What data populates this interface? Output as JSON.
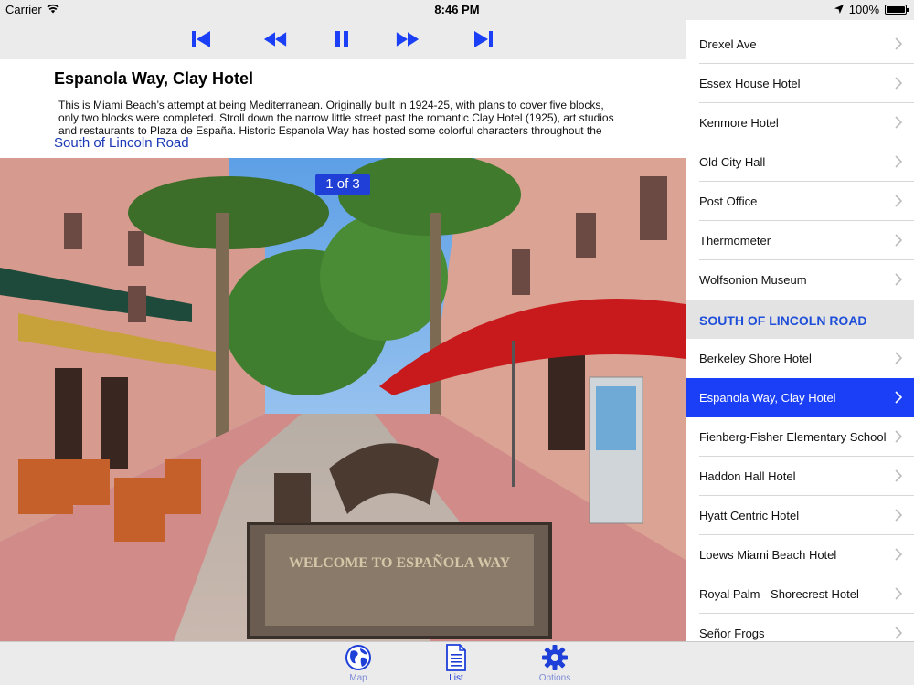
{
  "status_bar": {
    "carrier": "Carrier",
    "time": "8:46 PM",
    "battery": "100%",
    "battery_level": 1.0
  },
  "player": {
    "title": "Espanola Way, Clay Hotel",
    "description": "This is Miami Beach’s attempt at being Mediterranean. Originally built in 1924-25, with plans to cover five blocks, only two blocks were completed. Stroll down the narrow little street past the romantic Clay Hotel (1925), art studios and restaurants to Plaza de España. Historic Espanola Way has hosted some colorful characters throughout the years,",
    "region_link": "South of Lincoln Road",
    "page_indicator": "1 of 3",
    "sign_text": "WELCOME TO ESPAÑOLA WAY",
    "controls": [
      "skip-back",
      "rewind",
      "pause",
      "fast-forward",
      "skip-forward"
    ]
  },
  "list": {
    "items_top": [
      "Drexel Ave",
      "Essex House Hotel",
      "Kenmore Hotel",
      "Old City Hall",
      "Post Office",
      "Thermometer",
      "Wolfsonion Museum"
    ],
    "section_header": "SOUTH OF LINCOLN ROAD",
    "items_bottom": [
      "Berkeley Shore Hotel",
      "Espanola Way, Clay Hotel",
      "Fienberg-Fisher Elementary School",
      "Haddon Hall Hotel",
      "Hyatt Centric Hotel",
      "Loews Miami Beach Hotel",
      "Royal Palm - Shorecrest Hotel",
      "Señor Frogs"
    ],
    "selected": "Espanola Way, Clay Hotel"
  },
  "tabs": [
    {
      "label": "Map",
      "icon": "globe-icon",
      "active": false
    },
    {
      "label": "List",
      "icon": "document-icon",
      "active": true
    },
    {
      "label": "Options",
      "icon": "gear-icon",
      "active": false
    }
  ],
  "colors": {
    "accent": "#1b3ff6",
    "link": "#1a37b5",
    "section_header_bg": "#e3e3e3",
    "bar_bg": "#ebebeb"
  }
}
